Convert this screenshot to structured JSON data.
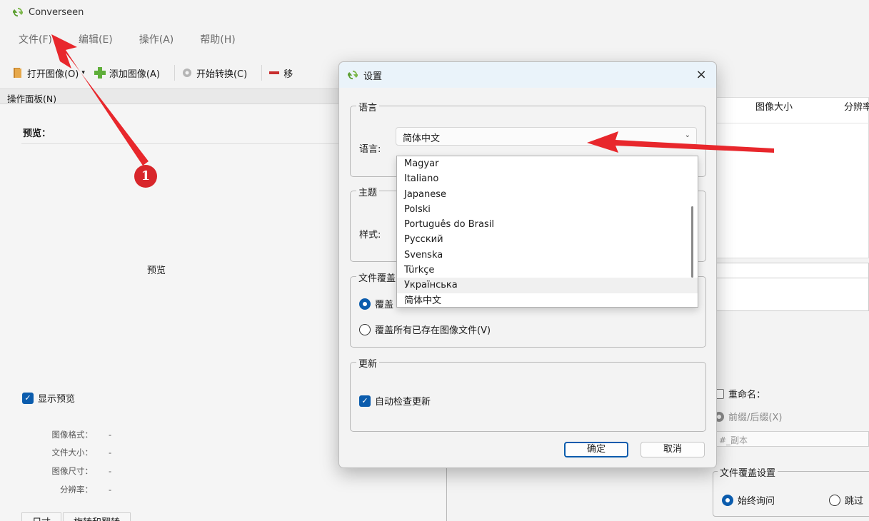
{
  "app": {
    "title": "Converseen"
  },
  "menu": [
    "文件(F)",
    "编辑(E)",
    "操作(A)",
    "帮助(H)"
  ],
  "toolbar": {
    "open": "打开图像(O)",
    "add": "添加图像(A)",
    "convert": "开始转换(C)",
    "remove": "移"
  },
  "left_panel": {
    "header": "操作面板(N)",
    "preview_title": "预览：",
    "preview_placeholder": "预览",
    "show_preview": "显示预览",
    "info": [
      {
        "key": "图像格式：",
        "value": "-"
      },
      {
        "key": "文件大小：",
        "value": "-"
      },
      {
        "key": "图像尺寸：",
        "value": "-"
      },
      {
        "key": "分辨率：",
        "value": "-"
      }
    ],
    "tabs": [
      "尺寸",
      "旋转和翻转"
    ]
  },
  "right_panel": {
    "columns": [
      "图像大小",
      "分辨率"
    ],
    "rename_label": "重命名：",
    "prefix_suffix": "前缀/后缀(X)",
    "suffix_value": "#_副本",
    "overwrite_group": "文件覆盖设置",
    "overwrite_options": [
      "始终询问",
      "跳过"
    ]
  },
  "dialog": {
    "title": "设置",
    "close": "×",
    "language_group": "语言",
    "language_label": "语言:",
    "language_value": "简体中文",
    "language_options": [
      "Magyar",
      "Italiano",
      "Japanese",
      "Polski",
      "Português do Brasil",
      "Русский",
      "Svenska",
      "Türkçe",
      "Українська",
      "简体中文"
    ],
    "theme_group": "主题",
    "style_label": "样式:",
    "overwrite_group": "文件覆盖",
    "overwrite_opt1": "覆盖",
    "overwrite_opt2": "覆盖所有已存在图像文件(V)",
    "update_group": "更新",
    "auto_update": "自动检查更新",
    "ok": "确定",
    "cancel": "取消"
  },
  "annotation": {
    "badge": "1",
    "color": "#e8272c"
  },
  "colors": {
    "accent": "#0b5cad",
    "arrow": "#e8272c"
  }
}
